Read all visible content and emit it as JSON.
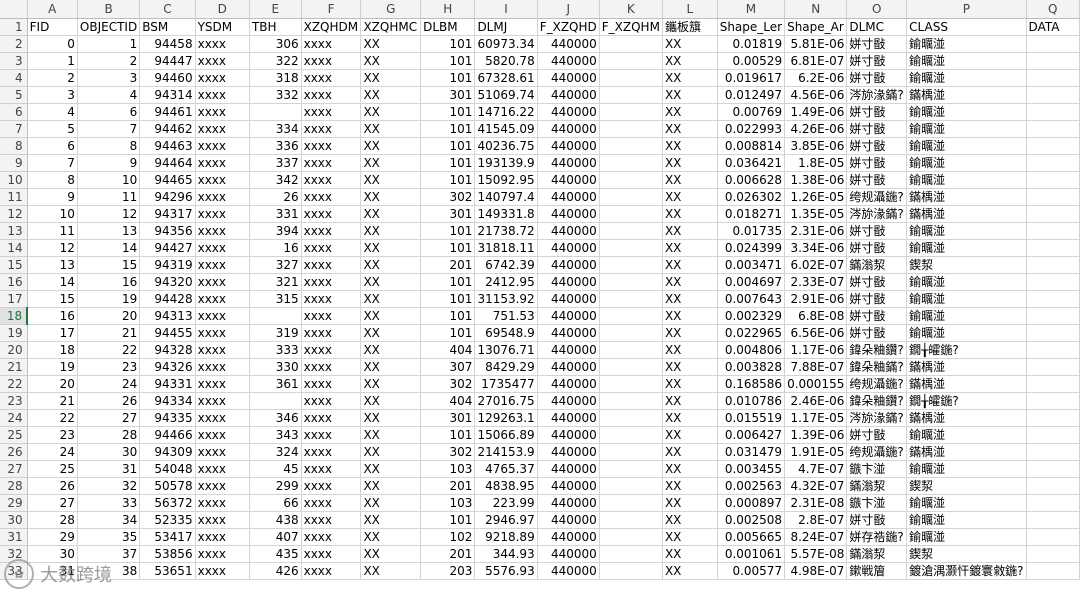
{
  "spreadsheet": {
    "column_letters": [
      "A",
      "B",
      "C",
      "D",
      "E",
      "F",
      "G",
      "H",
      "I",
      "J",
      "K",
      "L",
      "M",
      "N",
      "O",
      "P",
      "Q"
    ],
    "row_numbers": [
      "1",
      "2",
      "3",
      "4",
      "5",
      "6",
      "7",
      "8",
      "9",
      "10",
      "11",
      "12",
      "13",
      "14",
      "15",
      "16",
      "17",
      "18",
      "19",
      "20",
      "21",
      "22",
      "23",
      "24",
      "25",
      "26",
      "27",
      "28",
      "29",
      "30",
      "31",
      "32",
      "33"
    ],
    "active_row": "18",
    "header_row": [
      "FID",
      "OBJECTID",
      "BSM",
      "YSDM",
      "TBH",
      "XZQHDM",
      "XZQHMC",
      "DLBM",
      "DLMJ",
      "F_XZQHD",
      "F_XZQHM",
      "鑴板簱",
      "Shape_Ler",
      "Shape_Ar",
      "DLMC",
      "CLASS",
      "DATA"
    ],
    "rows": [
      [
        "0",
        "1",
        "94458",
        "xxxx",
        "306",
        "xxxx",
        "XX",
        "101",
        "60973.34",
        "440000",
        "",
        "XX",
        "0.01819",
        "5.81E-06",
        "姘寸敯",
        "鍮曞湴",
        ""
      ],
      [
        "1",
        "2",
        "94447",
        "xxxx",
        "322",
        "xxxx",
        "XX",
        "101",
        "5820.78",
        "440000",
        "",
        "XX",
        "0.00529",
        "6.81E-07",
        "姘寸敯",
        "鍮曞湴",
        ""
      ],
      [
        "2",
        "3",
        "94460",
        "xxxx",
        "318",
        "xxxx",
        "XX",
        "101",
        "67328.61",
        "440000",
        "",
        "XX",
        "0.019617",
        "6.2E-06",
        "姘寸敯",
        "鍮曞湴",
        ""
      ],
      [
        "3",
        "4",
        "94314",
        "xxxx",
        "332",
        "xxxx",
        "XX",
        "301",
        "51069.74",
        "440000",
        "",
        "XX",
        "0.012497",
        "4.56E-06",
        "涔旀湪鏋?",
        "鏋楀湴",
        ""
      ],
      [
        "4",
        "6",
        "94461",
        "xxxx",
        "",
        "xxxx",
        "XX",
        "101",
        "14716.22",
        "440000",
        "",
        "XX",
        "0.00769",
        "1.49E-06",
        "姘寸敯",
        "鍮曞湴",
        ""
      ],
      [
        "5",
        "7",
        "94462",
        "xxxx",
        "334",
        "xxxx",
        "XX",
        "101",
        "41545.09",
        "440000",
        "",
        "XX",
        "0.022993",
        "4.26E-06",
        "姘寸敯",
        "鍮曞湴",
        ""
      ],
      [
        "6",
        "8",
        "94463",
        "xxxx",
        "336",
        "xxxx",
        "XX",
        "101",
        "40236.75",
        "440000",
        "",
        "XX",
        "0.008814",
        "3.85E-06",
        "姘寸敯",
        "鍮曞湴",
        ""
      ],
      [
        "7",
        "9",
        "94464",
        "xxxx",
        "337",
        "xxxx",
        "XX",
        "101",
        "193139.9",
        "440000",
        "",
        "XX",
        "0.036421",
        "1.8E-05",
        "姘寸敯",
        "鍮曞湴",
        ""
      ],
      [
        "8",
        "10",
        "94465",
        "xxxx",
        "342",
        "xxxx",
        "XX",
        "101",
        "15092.95",
        "440000",
        "",
        "XX",
        "0.006628",
        "1.38E-06",
        "姘寸敯",
        "鍮曞湴",
        ""
      ],
      [
        "9",
        "11",
        "94296",
        "xxxx",
        "26",
        "xxxx",
        "XX",
        "302",
        "140797.4",
        "440000",
        "",
        "XX",
        "0.026302",
        "1.26E-05",
        "绔规灄鍦?",
        "鏋楀湴",
        ""
      ],
      [
        "10",
        "12",
        "94317",
        "xxxx",
        "331",
        "xxxx",
        "XX",
        "301",
        "149331.8",
        "440000",
        "",
        "XX",
        "0.018271",
        "1.35E-05",
        "涔旀湪鏋?",
        "鏋楀湴",
        ""
      ],
      [
        "11",
        "13",
        "94356",
        "xxxx",
        "394",
        "xxxx",
        "XX",
        "101",
        "21738.72",
        "440000",
        "",
        "XX",
        "0.01735",
        "2.31E-06",
        "姘寸敯",
        "鍮曞湴",
        ""
      ],
      [
        "12",
        "14",
        "94427",
        "xxxx",
        "16",
        "xxxx",
        "XX",
        "101",
        "31818.11",
        "440000",
        "",
        "XX",
        "0.024399",
        "3.34E-06",
        "姘寸敯",
        "鍮曞湴",
        ""
      ],
      [
        "13",
        "15",
        "94319",
        "xxxx",
        "327",
        "xxxx",
        "XX",
        "201",
        "6742.39",
        "440000",
        "",
        "XX",
        "0.003471",
        "6.02E-07",
        "鏋滃洯",
        "鍥洯",
        ""
      ],
      [
        "14",
        "16",
        "94320",
        "xxxx",
        "321",
        "xxxx",
        "XX",
        "101",
        "2412.95",
        "440000",
        "",
        "XX",
        "0.004697",
        "2.33E-07",
        "姘寸敯",
        "鍮曞湴",
        ""
      ],
      [
        "15",
        "19",
        "94428",
        "xxxx",
        "315",
        "xxxx",
        "XX",
        "101",
        "31153.92",
        "440000",
        "",
        "XX",
        "0.007643",
        "2.91E-06",
        "姘寸敯",
        "鍮曞湴",
        ""
      ],
      [
        "16",
        "20",
        "94313",
        "xxxx",
        "",
        "xxxx",
        "XX",
        "101",
        "751.53",
        "440000",
        "",
        "XX",
        "0.002329",
        "6.8E-08",
        "姘寸敯",
        "鍮曞湴",
        ""
      ],
      [
        "17",
        "21",
        "94455",
        "xxxx",
        "319",
        "xxxx",
        "XX",
        "101",
        "69548.9",
        "440000",
        "",
        "XX",
        "0.022965",
        "6.56E-06",
        "姘寸敯",
        "鍮曞湴",
        ""
      ],
      [
        "18",
        "22",
        "94328",
        "xxxx",
        "333",
        "xxxx",
        "XX",
        "404",
        "13076.71",
        "440000",
        "",
        "XX",
        "0.004806",
        "1.17E-06",
        "鍏朵粬鑽?",
        "鐗╁皬鍦?",
        ""
      ],
      [
        "19",
        "23",
        "94326",
        "xxxx",
        "330",
        "xxxx",
        "XX",
        "307",
        "8429.29",
        "440000",
        "",
        "XX",
        "0.003828",
        "7.88E-07",
        "鍏朵粬鏋?",
        "鏋楀湴",
        ""
      ],
      [
        "20",
        "24",
        "94331",
        "xxxx",
        "361",
        "xxxx",
        "XX",
        "302",
        "1735477",
        "440000",
        "",
        "XX",
        "0.168586",
        "0.000155",
        "绔规灄鍦?",
        "鏋楀湴",
        ""
      ],
      [
        "21",
        "26",
        "94334",
        "xxxx",
        "",
        "xxxx",
        "XX",
        "404",
        "27016.75",
        "440000",
        "",
        "XX",
        "0.010786",
        "2.46E-06",
        "鍏朵粬鑽?",
        "鐗╁皬鍦?",
        ""
      ],
      [
        "22",
        "27",
        "94335",
        "xxxx",
        "346",
        "xxxx",
        "XX",
        "301",
        "129263.1",
        "440000",
        "",
        "XX",
        "0.015519",
        "1.17E-05",
        "涔旀湪鏋?",
        "鏋楀湴",
        ""
      ],
      [
        "23",
        "28",
        "94466",
        "xxxx",
        "343",
        "xxxx",
        "XX",
        "101",
        "15066.89",
        "440000",
        "",
        "XX",
        "0.006427",
        "1.39E-06",
        "姘寸敯",
        "鍮曞湴",
        ""
      ],
      [
        "24",
        "30",
        "94309",
        "xxxx",
        "324",
        "xxxx",
        "XX",
        "302",
        "214153.9",
        "440000",
        "",
        "XX",
        "0.031479",
        "1.91E-05",
        "绔规灄鍦?",
        "鏋楀湴",
        ""
      ],
      [
        "25",
        "31",
        "54048",
        "xxxx",
        "45",
        "xxxx",
        "XX",
        "103",
        "4765.37",
        "440000",
        "",
        "XX",
        "0.003455",
        "4.7E-07",
        "鏃卞湴",
        "鍮曞湴",
        ""
      ],
      [
        "26",
        "32",
        "50578",
        "xxxx",
        "299",
        "xxxx",
        "XX",
        "201",
        "4838.95",
        "440000",
        "",
        "XX",
        "0.002563",
        "4.32E-07",
        "鏋滃洯",
        "鍥洯",
        ""
      ],
      [
        "27",
        "33",
        "56372",
        "xxxx",
        "66",
        "xxxx",
        "XX",
        "103",
        "223.99",
        "440000",
        "",
        "XX",
        "0.000897",
        "2.31E-08",
        "鏃卞湴",
        "鍮曞湴",
        ""
      ],
      [
        "28",
        "34",
        "52335",
        "xxxx",
        "438",
        "xxxx",
        "XX",
        "101",
        "2946.97",
        "440000",
        "",
        "XX",
        "0.002508",
        "2.8E-07",
        "姘寸敯",
        "鍮曞湴",
        ""
      ],
      [
        "29",
        "35",
        "53417",
        "xxxx",
        "407",
        "xxxx",
        "XX",
        "102",
        "9218.89",
        "440000",
        "",
        "XX",
        "0.005665",
        "8.24E-07",
        "姘存祰鍦?",
        "鍮曞湴",
        ""
      ],
      [
        "30",
        "37",
        "53856",
        "xxxx",
        "435",
        "xxxx",
        "XX",
        "201",
        "344.93",
        "440000",
        "",
        "XX",
        "0.001061",
        "5.57E-08",
        "鏋滃洯",
        "鍥洯",
        ""
      ],
      [
        "31",
        "38",
        "53651",
        "xxxx",
        "426",
        "xxxx",
        "XX",
        "203",
        "5576.93",
        "440000",
        "",
        "XX",
        "0.00577",
        "4.98E-07",
        "鏉戦篃",
        "鍍滄湡灏忓鍍寰敹鍦?",
        ""
      ]
    ]
  },
  "watermark": {
    "logo_glyph": "✿",
    "text": "大数跨境"
  }
}
